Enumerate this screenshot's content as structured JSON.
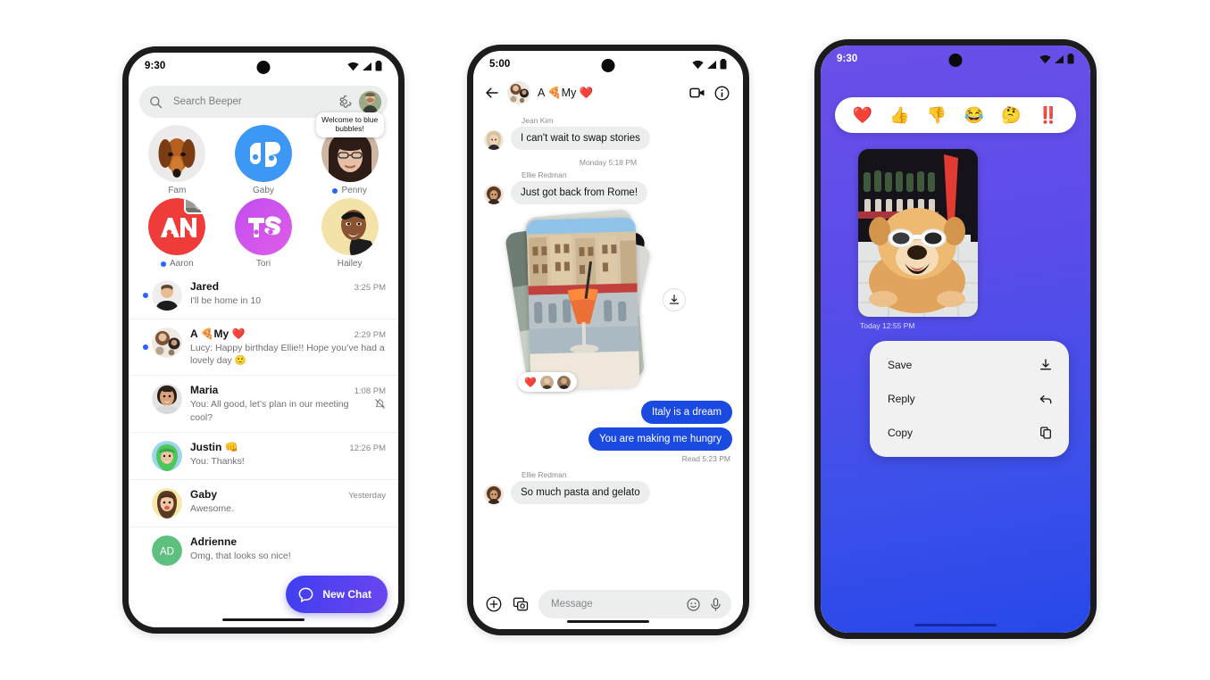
{
  "theme": {
    "accent_blue": "#1b4ae0",
    "unread_dot": "#2962ff",
    "fab_gradient_from": "#3f3ff0",
    "fab_gradient_to": "#6b46ef",
    "phone3_bg_top": "#6b4fe8",
    "phone3_bg_bottom": "#2748ea",
    "bubble_in_bg": "#eceded",
    "search_bg": "#eceded"
  },
  "phone1": {
    "status": {
      "time": "9:30",
      "wifi_icon": "wifi-icon",
      "signal_icon": "cellular-icon",
      "battery_icon": "battery-icon"
    },
    "search": {
      "placeholder": "Search Beeper",
      "search_icon": "search-icon",
      "settings_icon": "gear-icon",
      "avatar_icon": "profile-avatar"
    },
    "avatars": [
      {
        "name": "Fam",
        "unread": false,
        "kind": "photo-dog",
        "tooltip": "",
        "badge": false
      },
      {
        "name": "Gaby",
        "unread": false,
        "kind": "logo-gb",
        "tooltip": "",
        "badge": false
      },
      {
        "name": "Penny",
        "unread": true,
        "kind": "photo-woman",
        "tooltip": "Welcome to blue bubbles!",
        "badge": false
      },
      {
        "name": "Aaron",
        "unread": true,
        "kind": "logo-an",
        "tooltip": "",
        "badge": true
      },
      {
        "name": "Tori",
        "unread": false,
        "kind": "logo-ts",
        "tooltip": "",
        "badge": false
      },
      {
        "name": "Hailey",
        "unread": false,
        "kind": "photo-hailey",
        "tooltip": "",
        "badge": false
      }
    ],
    "chats": [
      {
        "name": "Jared",
        "time": "3:25 PM",
        "preview": "I'll be home in 10",
        "unread": true,
        "muted": false,
        "avatar": "avatar-jared"
      },
      {
        "name": "A 🍕My ❤️",
        "time": "2:29 PM",
        "preview": "Lucy: Happy birthday Ellie!! Hope you’ve had a lovely day  🙂",
        "unread": true,
        "muted": false,
        "avatar": "avatar-group"
      },
      {
        "name": "Maria",
        "time": "1:08 PM",
        "preview": "You: All good, let’s plan in our meeting cool?",
        "unread": false,
        "muted": true,
        "avatar": "avatar-maria"
      },
      {
        "name": "Justin 👊",
        "time": "12:26 PM",
        "preview": "You: Thanks!",
        "unread": false,
        "muted": false,
        "avatar": "avatar-justin"
      },
      {
        "name": "Gaby",
        "time": "Yesterday",
        "preview": "Awesome.",
        "unread": false,
        "muted": false,
        "avatar": "avatar-gaby"
      },
      {
        "name": "Adrienne",
        "time": "",
        "preview": "Omg, that looks so nice!",
        "unread": false,
        "muted": false,
        "avatar": "AD"
      }
    ],
    "fab": {
      "label": "New Chat",
      "icon": "chat-bubble-icon"
    }
  },
  "phone2": {
    "status": {
      "time": "5:00",
      "wifi_icon": "wifi-icon",
      "signal_icon": "cellular-icon",
      "battery_icon": "battery-icon"
    },
    "header": {
      "back_icon": "back-arrow-icon",
      "title": "A 🍕My ❤️",
      "video_icon": "video-call-icon",
      "info_icon": "info-icon",
      "avatar": "group-avatar"
    },
    "messages": [
      {
        "type": "incoming",
        "sender": "Jean Kim",
        "text": "I can't wait to swap stories",
        "avatar": "avatar-jean"
      },
      {
        "type": "daystamp",
        "text": "Monday 5:18 PM"
      },
      {
        "type": "incoming",
        "sender": "Ellie Redman",
        "text": "Just got back from Rome!",
        "avatar": "avatar-ellie"
      },
      {
        "type": "photo-stack",
        "download_icon": "download-icon",
        "reaction_emoji": "❤️"
      },
      {
        "type": "outgoing",
        "text": "Italy is a dream"
      },
      {
        "type": "outgoing",
        "text": "You are making me hungry"
      },
      {
        "type": "receipt",
        "text": "Read  5:23 PM"
      },
      {
        "type": "incoming",
        "sender": "Ellie Redman",
        "text": "So much pasta and gelato",
        "avatar": "avatar-ellie"
      }
    ],
    "composer": {
      "plus_icon": "add-attachment-icon",
      "gallery_icon": "gallery-camera-icon",
      "placeholder": "Message",
      "emoji_icon": "emoji-icon",
      "mic_icon": "microphone-icon"
    }
  },
  "phone3": {
    "status": {
      "time": "9:30",
      "wifi_icon": "wifi-icon",
      "signal_icon": "cellular-icon",
      "battery_icon": "battery-icon"
    },
    "reactions": [
      "❤️",
      "👍",
      "👎",
      "😂",
      "🤔",
      "‼️"
    ],
    "photo": {
      "alt": "dog-with-sunglasses-photo"
    },
    "timestamp": "Today  12:55 PM",
    "menu": [
      {
        "label": "Save",
        "icon": "download-icon"
      },
      {
        "label": "Reply",
        "icon": "reply-arrow-icon"
      },
      {
        "label": "Copy",
        "icon": "copy-icon"
      }
    ]
  }
}
